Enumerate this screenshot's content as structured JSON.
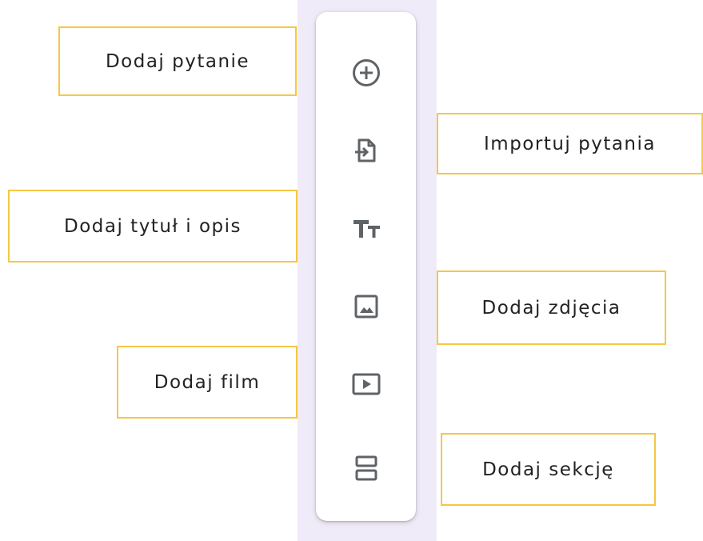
{
  "toolbar": {
    "accent_color": "#5f6368",
    "items": [
      {
        "icon": "add-circle-icon",
        "label": "Dodaj pytanie"
      },
      {
        "icon": "import-file-icon",
        "label": "Importuj pytania"
      },
      {
        "icon": "title-text-icon",
        "label": "Dodaj tytuł i opis"
      },
      {
        "icon": "image-icon",
        "label": "Dodaj zdjęcia"
      },
      {
        "icon": "video-icon",
        "label": "Dodaj film"
      },
      {
        "icon": "section-icon",
        "label": "Dodaj sekcję"
      }
    ]
  },
  "colors": {
    "callout_border": "#f6c744",
    "background_strip": "#f0ebf8"
  }
}
